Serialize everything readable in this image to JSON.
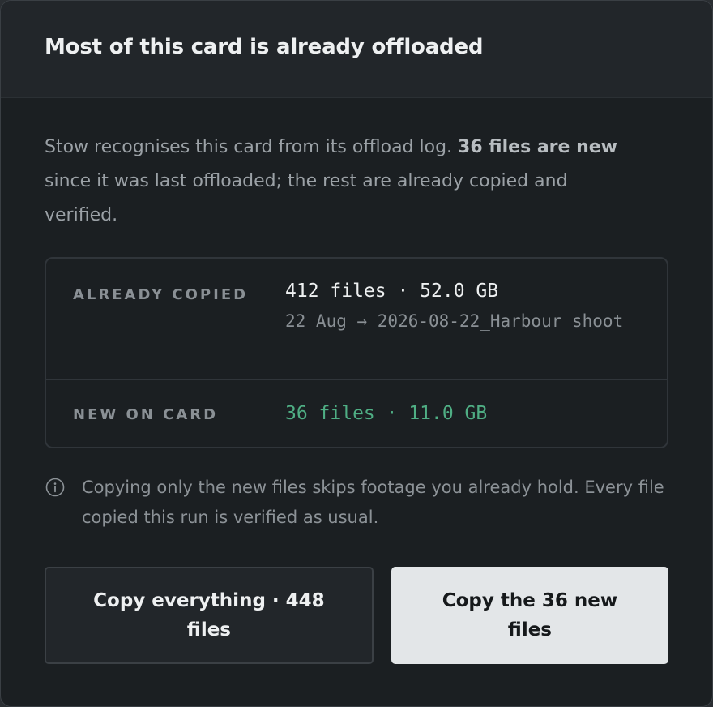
{
  "dialog": {
    "title": "Most of this card is already offloaded",
    "intro": {
      "lead": "Stow recognises this card from its offload log. ",
      "emphasis": "36 files are new",
      "rest": " since it was last offloaded; the rest are already copied and verified."
    },
    "summary": {
      "already_copied": {
        "label": "ALREADY COPIED",
        "value": "412 files · 52.0 GB",
        "detail": "22 Aug → 2026-08-22_Harbour shoot"
      },
      "new_on_card": {
        "label": "NEW ON CARD",
        "value": "36 files · 11.0 GB"
      }
    },
    "note": "Copying only the new files skips footage you already hold. Every file copied this run is verified as usual.",
    "actions": {
      "copy_everything": "Copy everything · 448 files",
      "copy_new": "Copy the 36 new files"
    }
  },
  "icons": {
    "note_icon": "info-icon"
  },
  "colors": {
    "background": "#1b1f22",
    "header": "#22262a",
    "accent_green": "#4fae84",
    "primary_button": "#e3e6e8"
  }
}
